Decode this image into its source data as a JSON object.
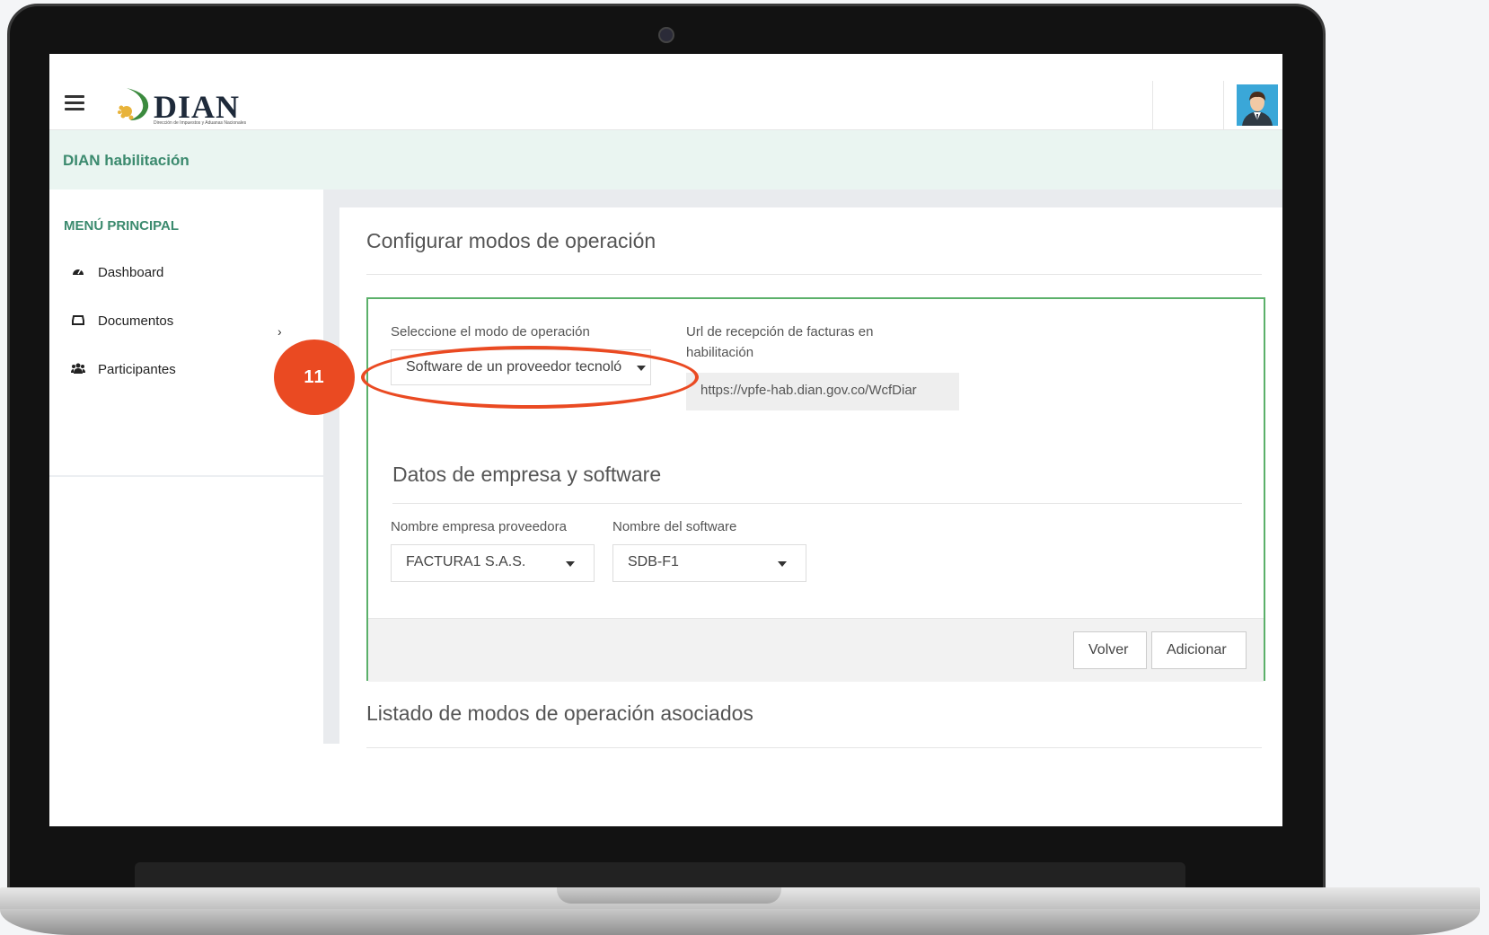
{
  "header": {
    "logo_text": "DIAN",
    "logo_subtitle": "Dirección de Impuestos y Aduanas Nacionales"
  },
  "subheader": {
    "title": "DIAN habilitación"
  },
  "sidebar": {
    "title": "MENÚ PRINCIPAL",
    "items": [
      {
        "label": "Dashboard",
        "icon": "dashboard-icon"
      },
      {
        "label": "Documentos",
        "icon": "inbox-icon",
        "has_submenu": true
      },
      {
        "label": "Participantes",
        "icon": "users-icon"
      }
    ]
  },
  "main": {
    "title": "Configurar modos de operación",
    "mode_label": "Seleccione el modo de operación",
    "mode_value": "Software de un proveedor tecnoló",
    "url_label_line1": "Url de recepción de facturas en",
    "url_label_line2": "habilitación",
    "url_value": "https://vpfe-hab.dian.gov.co/WcfDiar",
    "section_title": "Datos de empresa y software",
    "company_label": "Nombre empresa proveedora",
    "company_value": "FACTURA1 S.A.S.",
    "software_label": "Nombre del software",
    "software_value": "SDB-F1",
    "back_button": "Volver",
    "add_button": "Adicionar",
    "list_title": "Listado de modos de operación asociados"
  },
  "annotation": {
    "step_number": "11",
    "color": "#ea4a22"
  },
  "colors": {
    "brand_green": "#3b8a6e",
    "border_green": "#5bb06a"
  }
}
